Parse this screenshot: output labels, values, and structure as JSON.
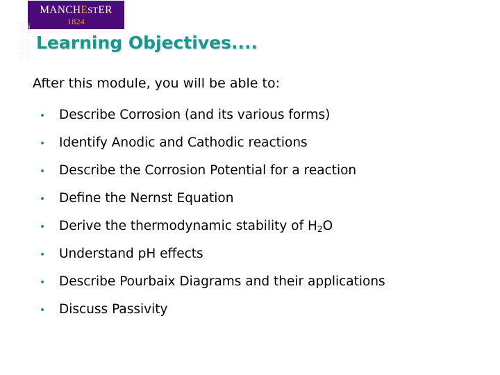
{
  "slide": {
    "title": "Learning Objectives....",
    "intro": "After this module, you will be able to:",
    "background_color": "#ffffff",
    "accent_color": "#17958f"
  },
  "logo": {
    "wordmark_prefix": "MANCH",
    "wordmark_accent": "E",
    "wordmark_suffix_small": "ST",
    "wordmark_suffix": "ER",
    "full_wordmark": "MANCHESTER",
    "year": "1824",
    "background_color": "#4b0a78",
    "text_color": "#ffffff",
    "accent_color": "#f2a900"
  },
  "vertical_brand": {
    "line1": "The University",
    "line2": "of Manchester",
    "text": "The University\nof Manchester",
    "color": "#f0f0f0"
  },
  "bullets": [
    {
      "text": "Describe Corrosion (and its various forms)"
    },
    {
      "text": "Identify Anodic and Cathodic reactions"
    },
    {
      "text": "Describe the Corrosion Potential for a reaction"
    },
    {
      "text": "Define the Nernst Equation"
    },
    {
      "text_before": "Derive the thermodynamic stability of H",
      "subscript": "2",
      "text_after": "O",
      "text": "Derive the thermodynamic stability of H2O"
    },
    {
      "text": "Understand pH effects"
    },
    {
      "text": "Describe Pourbaix Diagrams and their applications"
    },
    {
      "text": "Discuss Passivity"
    }
  ]
}
